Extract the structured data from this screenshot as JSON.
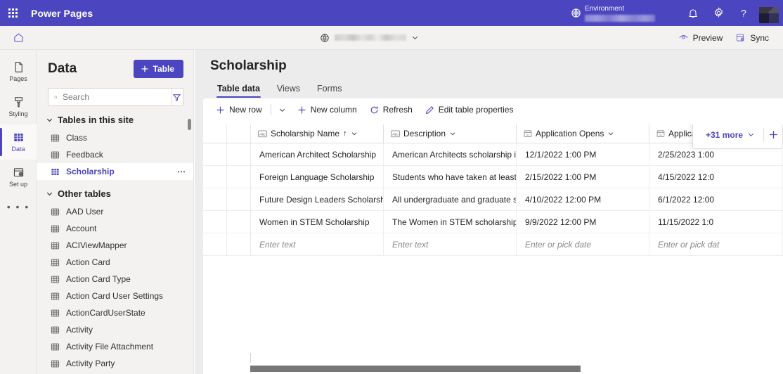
{
  "topbar": {
    "waffle_label": "app-launcher",
    "app_title": "Power Pages",
    "environment_label": "Environment",
    "environment_value": "",
    "icons": {
      "globe": "globe-icon",
      "notifications": "bell-icon",
      "settings": "gear-icon",
      "help": "question-mark-icon",
      "avatar": "user-avatar"
    },
    "accent_color": "#4b45bf"
  },
  "subbar": {
    "home": "home-icon",
    "site_name": "",
    "preview_label": "Preview",
    "sync_label": "Sync"
  },
  "rail": {
    "items": [
      {
        "label": "Pages",
        "icon": "page-icon",
        "active": false
      },
      {
        "label": "Styling",
        "icon": "paint-brush-icon",
        "active": false
      },
      {
        "label": "Data",
        "icon": "table-grid-icon",
        "active": true
      },
      {
        "label": "Set up",
        "icon": "setup-gear-icon",
        "active": false
      }
    ],
    "more_label": "• • •"
  },
  "datapanel": {
    "title": "Data",
    "add_table_label": "Table",
    "search_placeholder": "Search",
    "search_value": "",
    "filter_icon": "filter-icon",
    "sections": [
      {
        "title": "Tables in this site",
        "expanded": true,
        "items": [
          {
            "label": "Class",
            "selected": false
          },
          {
            "label": "Feedback",
            "selected": false
          },
          {
            "label": "Scholarship",
            "selected": true
          }
        ]
      },
      {
        "title": "Other tables",
        "expanded": true,
        "items": [
          {
            "label": "AAD User",
            "selected": false
          },
          {
            "label": "Account",
            "selected": false
          },
          {
            "label": "ACIViewMapper",
            "selected": false
          },
          {
            "label": "Action Card",
            "selected": false
          },
          {
            "label": "Action Card Type",
            "selected": false
          },
          {
            "label": "Action Card User Settings",
            "selected": false
          },
          {
            "label": "ActionCardUserState",
            "selected": false
          },
          {
            "label": "Activity",
            "selected": false
          },
          {
            "label": "Activity File Attachment",
            "selected": false
          },
          {
            "label": "Activity Party",
            "selected": false
          }
        ]
      }
    ]
  },
  "main": {
    "page_title": "Scholarship",
    "tabs": [
      {
        "label": "Table data",
        "active": true
      },
      {
        "label": "Views",
        "active": false
      },
      {
        "label": "Forms",
        "active": false
      }
    ],
    "commands": [
      {
        "label": "New row",
        "icon": "plus-icon"
      },
      {
        "label": "New column",
        "icon": "plus-icon"
      },
      {
        "label": "Refresh",
        "icon": "refresh-icon"
      },
      {
        "label": "Edit table properties",
        "icon": "pencil-icon"
      }
    ],
    "new_row_caret": "chevron-down-icon",
    "more_columns_label": "+31 more",
    "add_column_icon": "plus-icon"
  },
  "grid": {
    "columns": [
      {
        "header": "Scholarship Name",
        "type_icon": "text-abc-icon",
        "sorted": "asc",
        "sort_glyph": "↑"
      },
      {
        "header": "Description",
        "type_icon": "text-abc-icon",
        "sorted": "",
        "sort_glyph": ""
      },
      {
        "header": "Application Opens",
        "type_icon": "calendar-icon",
        "sorted": "",
        "sort_glyph": ""
      },
      {
        "header": "Application D",
        "type_icon": "calendar-icon",
        "sorted": "",
        "sort_glyph": ""
      }
    ],
    "rows": [
      {
        "name": "American Architect Scholarship",
        "description": "American Architects scholarship is...",
        "opens": "12/1/2022 1:00 PM",
        "deadline": "2/25/2023 1:00"
      },
      {
        "name": "Foreign Language Scholarship",
        "description": "Students who have taken at least ...",
        "opens": "2/15/2022 1:00 PM",
        "deadline": "4/15/2022 12:0"
      },
      {
        "name": "Future Design Leaders Scholarship",
        "description": "All undergraduate and graduate s...",
        "opens": "4/10/2022 12:00 PM",
        "deadline": "6/1/2022 12:00"
      },
      {
        "name": "Women in STEM Scholarship",
        "description": "The Women in STEM scholarship i...",
        "opens": "9/9/2022 12:00 PM",
        "deadline": "11/15/2022 1:0"
      }
    ],
    "new_row_placeholders": {
      "name": "Enter text",
      "description": "Enter text",
      "opens": "Enter or pick date",
      "deadline": "Enter or pick dat"
    }
  }
}
